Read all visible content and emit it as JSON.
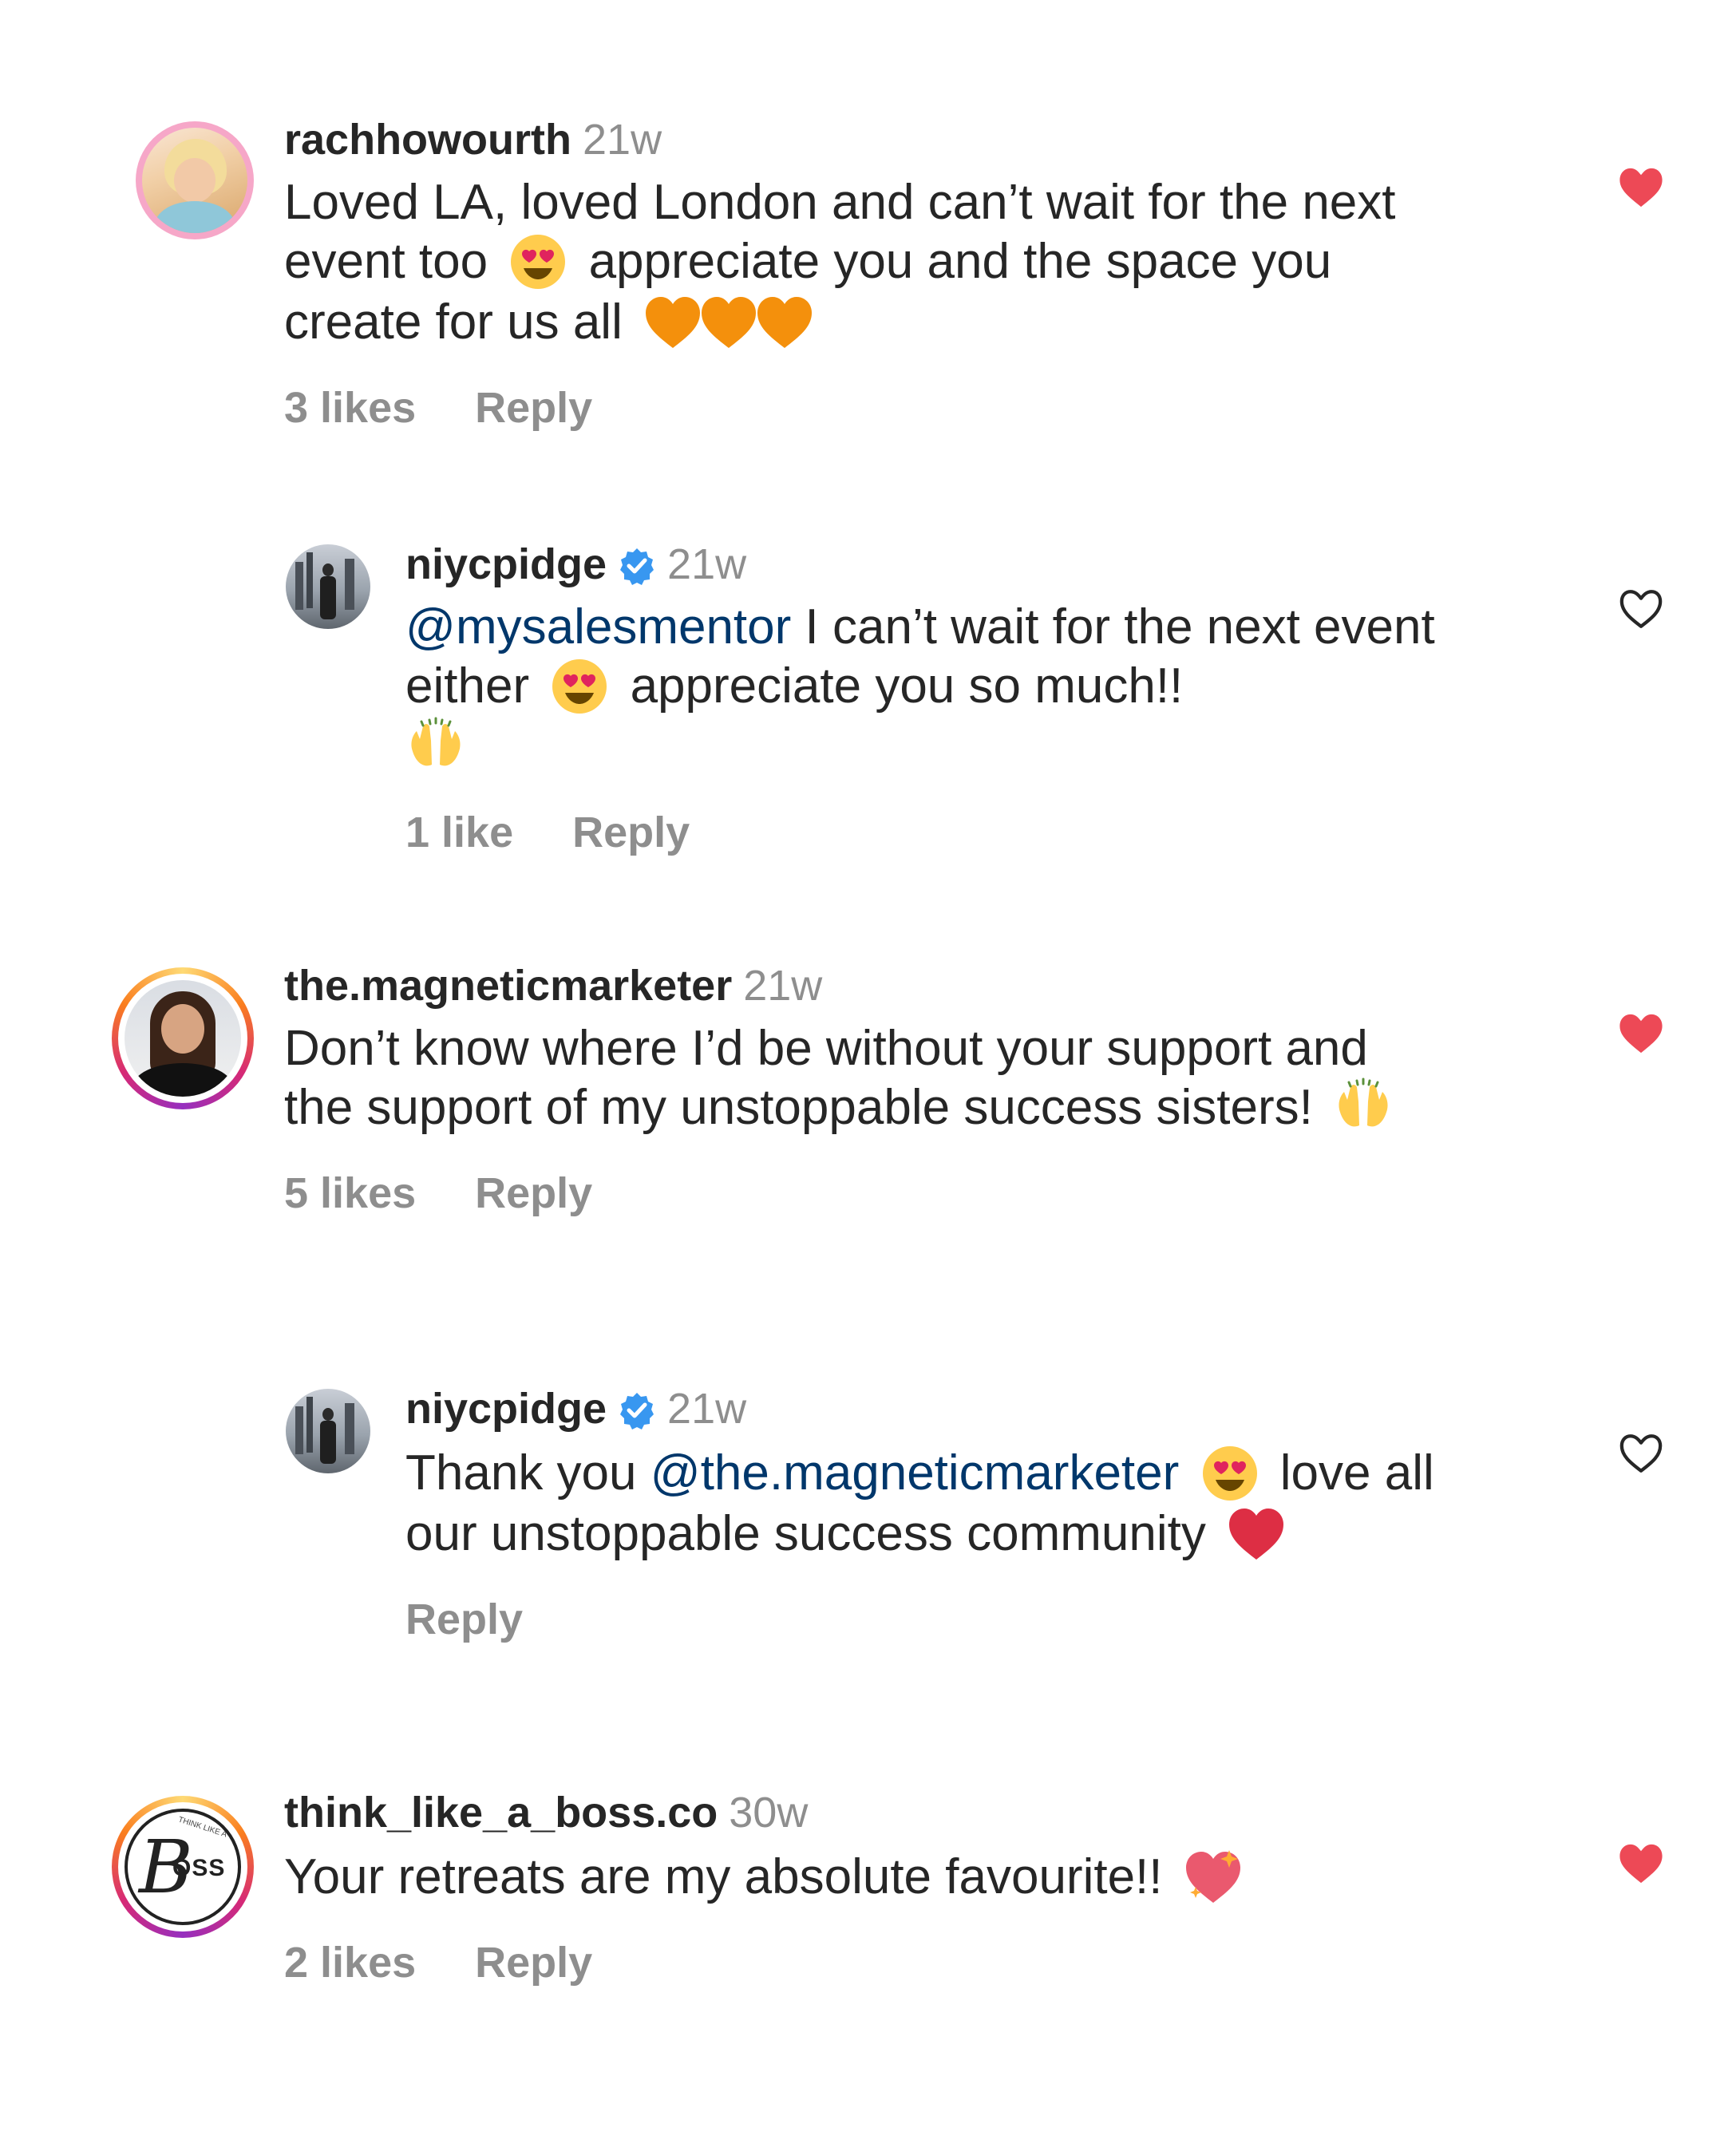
{
  "comments": [
    {
      "username": "rachhowourth",
      "time": "21w",
      "text_a": "Loved LA, loved London and can’t wait for the next event too",
      "text_b": "appreciate you and the space you create for us all",
      "likes": "3 likes",
      "reply": "Reply",
      "liked": true
    },
    {
      "username": "niycpidge",
      "time": "21w",
      "mention": "@mysalesmentor",
      "text_a": "I can’t wait for the next event either",
      "text_b": "appreciate you so much!!",
      "likes": "1 like",
      "reply": "Reply",
      "liked": false
    },
    {
      "username": "the.magneticmarketer",
      "time": "21w",
      "text_a": "Don’t know where I’d be without your support and the support of my unstoppable success sisters!",
      "likes": "5 likes",
      "reply": "Reply",
      "liked": true
    },
    {
      "username": "niycpidge",
      "time": "21w",
      "text_pre": "Thank you",
      "mention": "@the.magneticmarketer",
      "text_b": "love all our unstoppable success community",
      "reply": "Reply",
      "liked": false
    },
    {
      "username": "think_like_a_boss.co",
      "time": "30w",
      "text_a": "Your retreats are my absolute favourite!!",
      "likes": "2 likes",
      "reply": "Reply",
      "liked": true
    }
  ],
  "avatars": {
    "c5_logo_text": "OSS",
    "c5_logo_arc": "THINK LIKE A"
  },
  "icons": {
    "liked_heart": "heart-filled-icon",
    "unliked_heart": "heart-outline-icon",
    "verified": "verified-badge-icon",
    "emojis": [
      "heart-eyes-emoji",
      "orange-heart-emoji",
      "raising-hands-emoji",
      "red-heart-emoji",
      "sparkling-heart-emoji"
    ]
  },
  "colors": {
    "liked": "#ed4956",
    "mention": "#00376b",
    "secondary_text": "#8e8e8e",
    "verified": "#3897f0",
    "orange_heart": "#f4900c"
  }
}
